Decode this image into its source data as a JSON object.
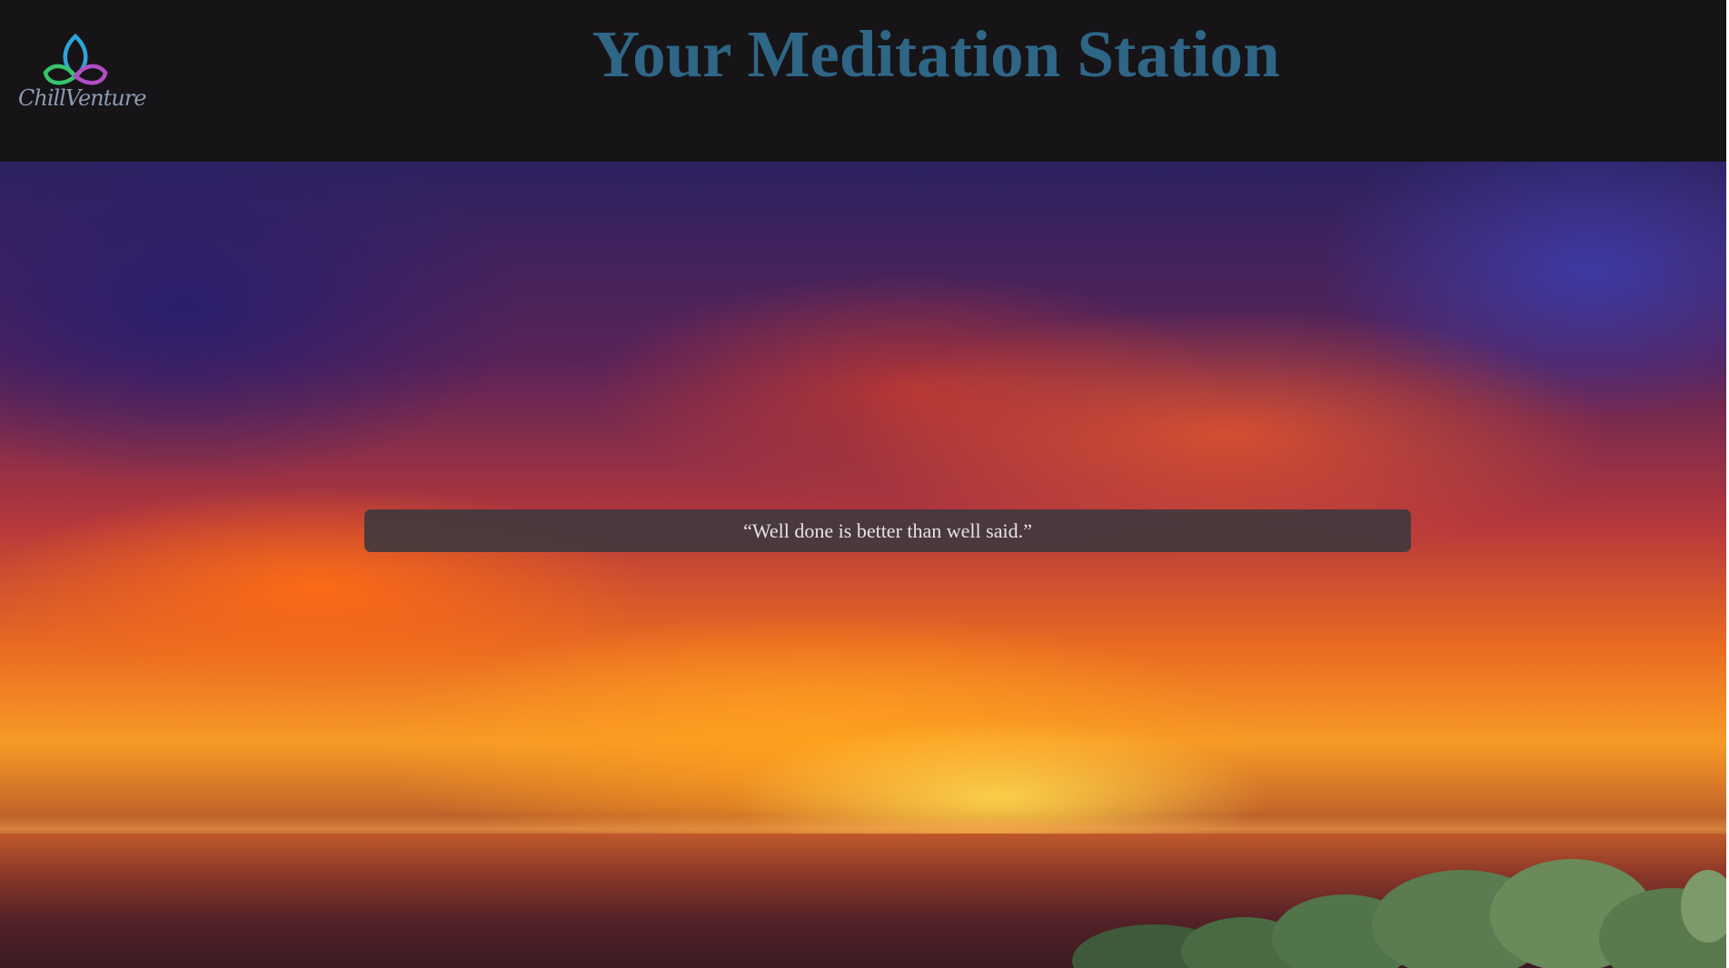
{
  "header": {
    "logo_text": "ChillVenture",
    "title": "Your Meditation Station"
  },
  "hero": {
    "quote": "“Well done is better than well said.”"
  },
  "colors": {
    "header_bg": "#161417",
    "title": "#2f6585",
    "quote_box_bg": "#3a383e",
    "quote_text": "#e6e3e6"
  },
  "icons": {
    "logo": "triquetra-icon"
  }
}
